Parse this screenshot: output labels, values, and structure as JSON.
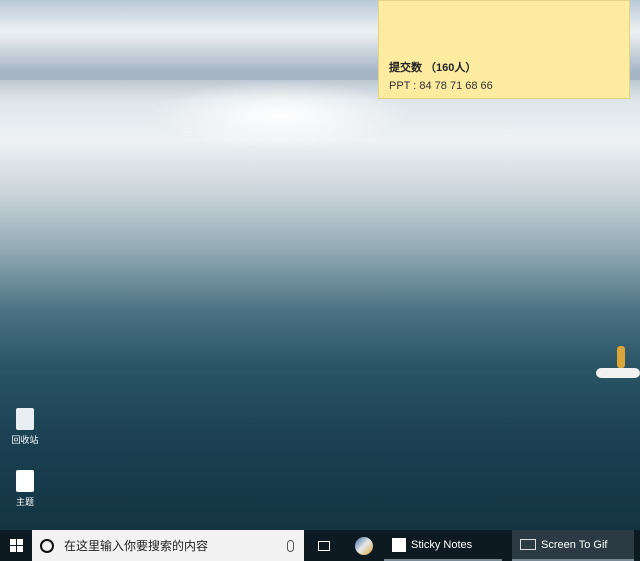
{
  "sticky_note": {
    "heading": "提交数  （160人）",
    "line": "PPT : 84  78  71  68 66"
  },
  "desktop_icons": [
    {
      "label": "回收站"
    },
    {
      "label": "主题"
    }
  ],
  "taskbar": {
    "search_placeholder": "在这里输入你要搜索的内容",
    "apps": [
      {
        "label": "Sticky Notes"
      },
      {
        "label": "Screen To Gif"
      }
    ]
  }
}
